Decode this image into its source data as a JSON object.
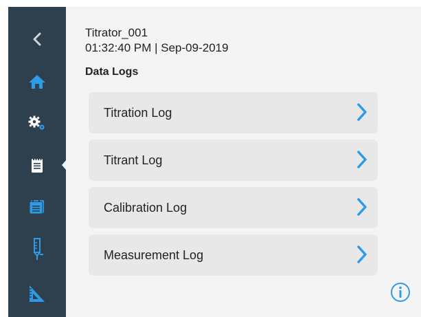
{
  "header": {
    "device_name": "Titrator_001",
    "datetime": "01:32:40 PM | Sep-09-2019"
  },
  "section": {
    "title": "Data Logs"
  },
  "logs": [
    {
      "label": "Titration Log"
    },
    {
      "label": "Titrant Log"
    },
    {
      "label": "Calibration Log"
    },
    {
      "label": "Measurement Log"
    }
  ],
  "sidebar": {
    "items": [
      {
        "icon": "back-chevron-icon"
      },
      {
        "icon": "home-icon"
      },
      {
        "icon": "settings-gears-icon"
      },
      {
        "icon": "notepad-icon",
        "selected": true
      },
      {
        "icon": "calendar-list-icon"
      },
      {
        "icon": "burette-icon"
      },
      {
        "icon": "ruler-triangle-icon"
      }
    ]
  },
  "colors": {
    "sidebar_bg": "#2e3f4d",
    "accent": "#2f9be6",
    "row_bg": "#e8e8e8",
    "screen_bg": "#f4f4f4"
  }
}
